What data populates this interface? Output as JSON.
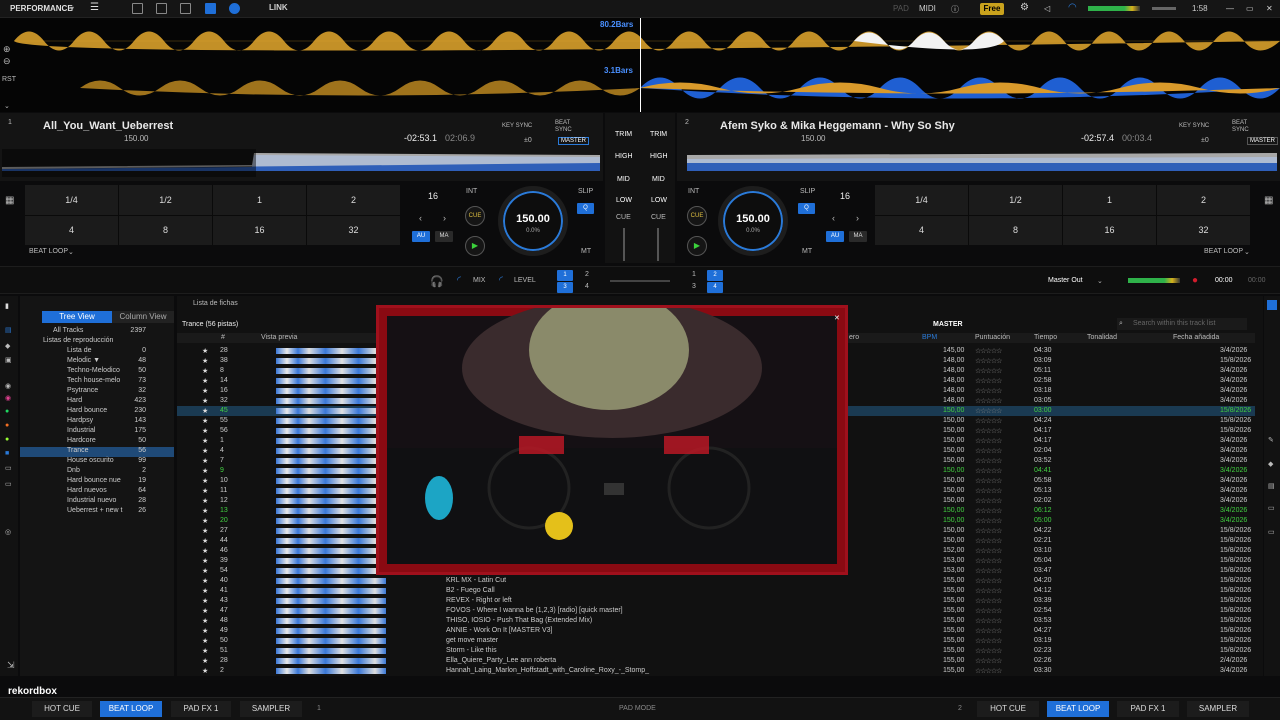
{
  "topbar": {
    "mode": "PERFORMANCE",
    "link": "LINK",
    "pad": "PAD",
    "midi": "MIDI",
    "plan": "Free",
    "time": "1:58"
  },
  "waveform": {
    "deck1_bars": "80.2Bars",
    "deck2_bars": "3.1Bars",
    "rst": "RST"
  },
  "deck1": {
    "number": "1",
    "title": "All_You_Want_Ueberrest",
    "bpm_label": "150.00",
    "time_remaining": "-02:53.1",
    "time_elapsed": "02:06.9",
    "key_sync": "KEY SYNC",
    "beat_sync": "BEAT SYNC",
    "key_offset": "±0",
    "master": "MASTER",
    "beat_count": "16",
    "int": "INT",
    "slip": "SLIP",
    "cue": "CUE",
    "q": "Q",
    "au": "AU",
    "ma": "MA",
    "mt": "MT",
    "jog_bpm": "150.00",
    "jog_pitch": "0.0%",
    "jog_range": "±6",
    "beat_loop": "BEAT LOOP",
    "pads": [
      "1/4",
      "1/2",
      "1",
      "2",
      "4",
      "8",
      "16",
      "32"
    ]
  },
  "deck2": {
    "number": "2",
    "title": "Afem Syko & Mika Heggemann - Why So Shy",
    "bpm_label": "150.00",
    "time_remaining": "-02:57.4",
    "time_elapsed": "00:03.4",
    "key_sync": "KEY SYNC",
    "beat_sync": "BEAT SYNC",
    "key_offset": "±0",
    "master": "MASTER",
    "beat_count": "16",
    "int": "INT",
    "slip": "SLIP",
    "cue": "CUE",
    "q": "Q",
    "au": "AU",
    "ma": "MA",
    "mt": "MT",
    "jog_bpm": "150.00",
    "jog_pitch": "0.0%",
    "jog_range": "±6",
    "beat_loop": "BEAT LOOP",
    "pads": [
      "1/4",
      "1/2",
      "1",
      "2",
      "4",
      "8",
      "16",
      "32"
    ]
  },
  "mixer": {
    "trim": "TRIM",
    "high": "HIGH",
    "mid": "MID",
    "low": "LOW",
    "cue": "CUE"
  },
  "midbar": {
    "mix": "MIX",
    "level": "LEVEL",
    "master_out": "Master Out",
    "time_left": "00:00",
    "time_right": "00:00"
  },
  "tree": {
    "tab_tree": "Tree View",
    "tab_column": "Column View",
    "all_tracks": "All Tracks",
    "all_tracks_count": "2397",
    "playlists_header": "Listas de reproducción",
    "items": [
      {
        "name": "Lista de",
        "count": "0"
      },
      {
        "name": "Melodic ▼",
        "count": "48"
      },
      {
        "name": "Techno-Melodico",
        "count": "50"
      },
      {
        "name": "Tech house-melo",
        "count": "73"
      },
      {
        "name": "Psytrance",
        "count": "32"
      },
      {
        "name": "Hard",
        "count": "423"
      },
      {
        "name": "Hard bounce",
        "count": "230"
      },
      {
        "name": "Hardpsy",
        "count": "143"
      },
      {
        "name": "Industrial",
        "count": "175"
      },
      {
        "name": "Hardcore",
        "count": "50"
      },
      {
        "name": "Trance",
        "count": "56"
      },
      {
        "name": "House oscurito",
        "count": "99"
      },
      {
        "name": "Dnb",
        "count": "2"
      },
      {
        "name": "Hard bounce nue",
        "count": "19"
      },
      {
        "name": "Hard nuevos",
        "count": "64"
      },
      {
        "name": "Industrial nuevo",
        "count": "28"
      },
      {
        "name": "Ueberrest + new t",
        "count": "26"
      }
    ]
  },
  "tracks": {
    "section_title": "Lista de fichas",
    "playlist_title": "Trance (56 pistas)",
    "search_placeholder": "Search within this track list",
    "master_label": "MASTER",
    "headers": {
      "num": "#",
      "preview": "Vista previa",
      "genre": "ero",
      "bpm": "BPM",
      "rating": "Puntuación",
      "time": "Tiempo",
      "key": "Tonalidad",
      "date": "Fecha añadida"
    },
    "rows": [
      {
        "num": "28",
        "title": "",
        "bpm": "145,00",
        "time": "04:30",
        "date": "3/4/2026"
      },
      {
        "num": "38",
        "title": "",
        "bpm": "148,00",
        "time": "03:09",
        "date": "15/8/2026"
      },
      {
        "num": "8",
        "title": "",
        "bpm": "148,00",
        "time": "05:11",
        "date": "3/4/2026"
      },
      {
        "num": "14",
        "title": "",
        "bpm": "148,00",
        "time": "02:58",
        "date": "3/4/2026"
      },
      {
        "num": "16",
        "title": "",
        "bpm": "148,00",
        "time": "03:18",
        "date": "3/4/2026"
      },
      {
        "num": "32",
        "title": "",
        "bpm": "148,00",
        "time": "03:05",
        "date": "3/4/2026"
      },
      {
        "num": "45",
        "title": "",
        "bpm": "150,00",
        "time": "03:00",
        "date": "15/8/2026",
        "selected": true
      },
      {
        "num": "55",
        "title": "",
        "bpm": "150,00",
        "time": "04:24",
        "date": "15/8/2026"
      },
      {
        "num": "56",
        "title": "",
        "bpm": "150,00",
        "time": "04:17",
        "date": "15/8/2026"
      },
      {
        "num": "1",
        "title": "",
        "bpm": "150,00",
        "time": "04:17",
        "date": "3/4/2026"
      },
      {
        "num": "4",
        "title": "",
        "bpm": "150,00",
        "time": "02:04",
        "date": "3/4/2026"
      },
      {
        "num": "7",
        "title": "",
        "bpm": "150,00",
        "time": "03:52",
        "date": "3/4/2026"
      },
      {
        "num": "9",
        "title": "",
        "bpm": "150,00",
        "time": "04:41",
        "date": "3/4/2026",
        "green": true
      },
      {
        "num": "10",
        "title": "",
        "bpm": "150,00",
        "time": "05:58",
        "date": "3/4/2026"
      },
      {
        "num": "11",
        "title": "",
        "bpm": "150,00",
        "time": "05:13",
        "date": "3/4/2026"
      },
      {
        "num": "12",
        "title": "",
        "bpm": "150,00",
        "time": "02:02",
        "date": "3/4/2026"
      },
      {
        "num": "13",
        "title": "",
        "bpm": "150,00",
        "time": "06:12",
        "date": "3/4/2026",
        "green": true
      },
      {
        "num": "20",
        "title": "",
        "bpm": "150,00",
        "time": "05:00",
        "date": "3/4/2026",
        "green": true
      },
      {
        "num": "27",
        "title": "",
        "bpm": "150,00",
        "time": "04:22",
        "date": "15/8/2026"
      },
      {
        "num": "44",
        "title": "",
        "bpm": "150,00",
        "time": "02:21",
        "date": "15/8/2026"
      },
      {
        "num": "46",
        "title": "",
        "bpm": "152,00",
        "time": "03:10",
        "date": "15/8/2026"
      },
      {
        "num": "39",
        "title": "",
        "bpm": "153,00",
        "time": "05:04",
        "date": "15/8/2026"
      },
      {
        "num": "54",
        "title": "",
        "bpm": "153,00",
        "time": "03:47",
        "date": "15/8/2026"
      },
      {
        "num": "40",
        "title": "KRL MX - Latin Cut",
        "bpm": "155,00",
        "time": "04:20",
        "date": "15/8/2026"
      },
      {
        "num": "41",
        "title": "B2 - Fuego Call",
        "bpm": "155,00",
        "time": "04:12",
        "date": "15/8/2026"
      },
      {
        "num": "43",
        "title": "REVEX - Right or left",
        "bpm": "155,00",
        "time": "03:39",
        "date": "15/8/2026"
      },
      {
        "num": "47",
        "title": "FOVOS - Where I wanna be (1,2,3) [radio] [quick master]",
        "bpm": "155,00",
        "time": "02:54",
        "date": "15/8/2026"
      },
      {
        "num": "48",
        "title": "THISO, IOSIO - Push That Bag (Extended Mix)",
        "bpm": "155,00",
        "time": "03:53",
        "date": "15/8/2026"
      },
      {
        "num": "49",
        "title": "ANNIE - Work On It [MASTER V3]",
        "bpm": "155,00",
        "time": "04:27",
        "date": "15/8/2026"
      },
      {
        "num": "50",
        "title": "get move master",
        "bpm": "155,00",
        "time": "03:19",
        "date": "15/8/2026"
      },
      {
        "num": "51",
        "title": "Storm - Like this",
        "bpm": "155,00",
        "time": "02:23",
        "date": "15/8/2026"
      },
      {
        "num": "28",
        "title": "Ella_Quiere_Party_Lee ann roberta",
        "bpm": "155,00",
        "time": "02:26",
        "date": "2/4/2026"
      },
      {
        "num": "2",
        "title": "Hannah_Laing_Marlon_Hoffstadt_with_Caroline_Roxy_-_Stomp_",
        "bpm": "155,00",
        "time": "03:30",
        "date": "3/4/2026"
      }
    ]
  },
  "bottombar": {
    "left": [
      "HOT CUE",
      "BEAT LOOP",
      "PAD FX 1",
      "SAMPLER"
    ],
    "right": [
      "HOT CUE",
      "BEAT LOOP",
      "PAD FX 1",
      "SAMPLER"
    ],
    "deck1_num": "1",
    "deck2_num": "2",
    "mode": "PAD MODE",
    "logo": "rekordbox"
  }
}
